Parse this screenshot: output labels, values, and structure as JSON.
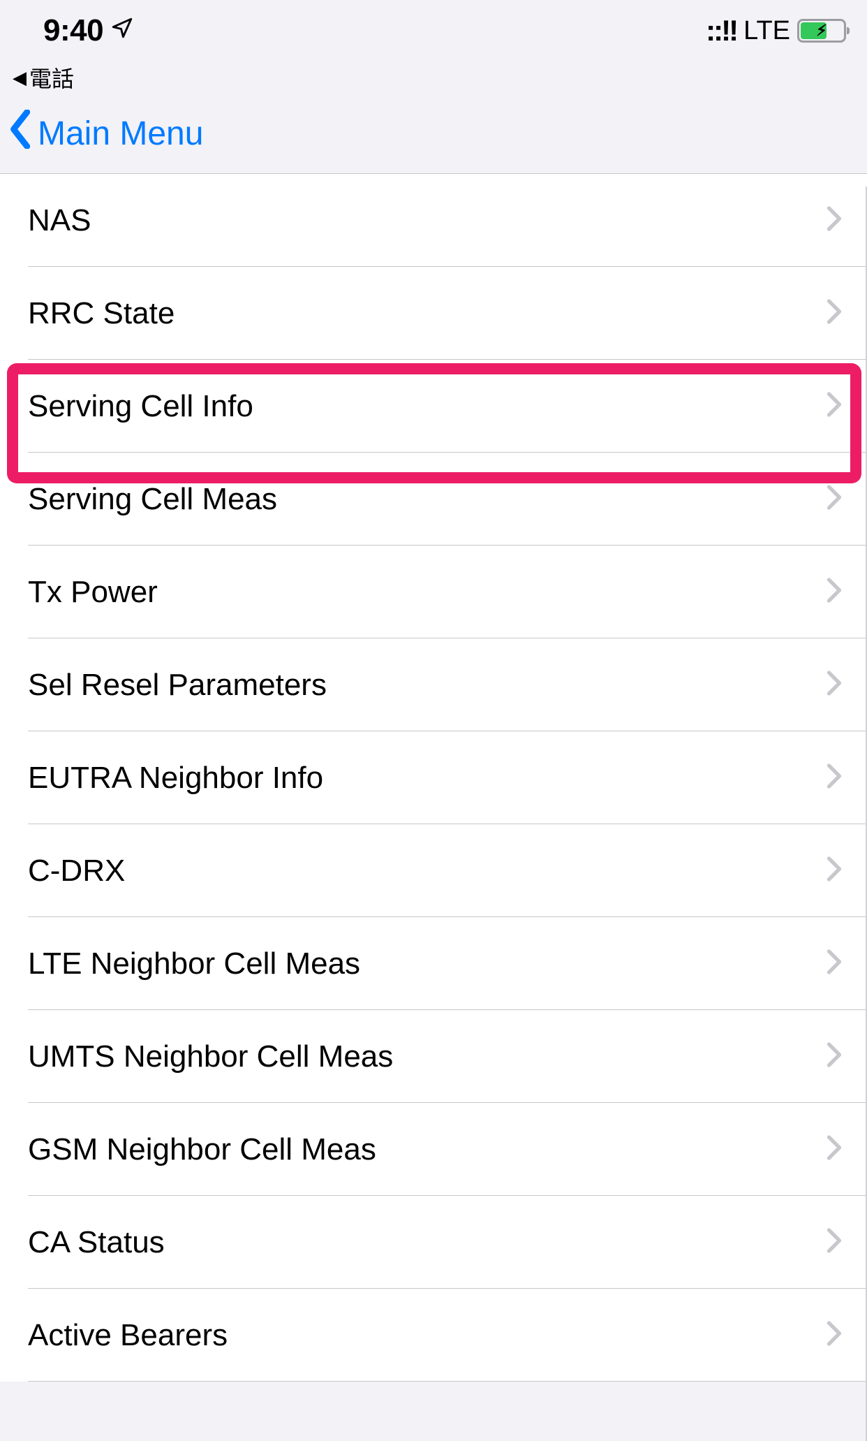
{
  "status_bar": {
    "time": "9:40",
    "location_icon": "location-outline-icon",
    "signal": "::!!",
    "network": "LTE",
    "battery_icon": "battery-charging-icon"
  },
  "breadcrumb": {
    "caret": "◀",
    "label": "電話"
  },
  "nav": {
    "back_label": "Main Menu"
  },
  "menu": {
    "items": [
      {
        "label": "NAS"
      },
      {
        "label": "RRC State"
      },
      {
        "label": "Serving Cell Info"
      },
      {
        "label": "Serving Cell Meas"
      },
      {
        "label": "Tx Power"
      },
      {
        "label": "Sel Resel Parameters"
      },
      {
        "label": "EUTRA Neighbor Info"
      },
      {
        "label": "C-DRX"
      },
      {
        "label": "LTE Neighbor Cell Meas"
      },
      {
        "label": "UMTS Neighbor Cell Meas"
      },
      {
        "label": "GSM Neighbor Cell Meas"
      },
      {
        "label": "CA Status"
      },
      {
        "label": "Active Bearers"
      }
    ]
  },
  "highlight": {
    "color": "#ec1d64",
    "target_index": 2
  }
}
